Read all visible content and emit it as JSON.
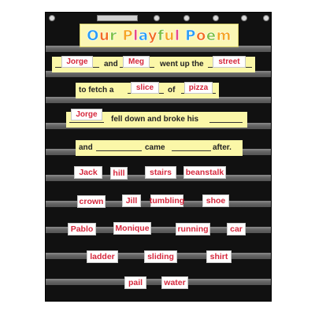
{
  "chart": {
    "title": "Our Playful Poem",
    "title_colors": [
      "#2a9df4",
      "#f36c21",
      "#7bc043",
      "#f5a623",
      "#e84a8a"
    ],
    "board_color": "#111111",
    "strip_color": "#fbf7a8",
    "word_color": "#d6283d"
  },
  "poem": {
    "line1": {
      "word1": "Jorge",
      "conj": "and",
      "word2": "Meg",
      "text": "went up the",
      "word3": "street"
    },
    "line2": {
      "text1": "to fetch a",
      "word1": "slice",
      "text2": "of",
      "word2": "pizza"
    },
    "line3": {
      "word1": "Jorge",
      "text": "fell down and broke his"
    },
    "line4": {
      "text1": "and",
      "text2": "came",
      "text3": "after."
    }
  },
  "word_bank": [
    "Jack",
    "hill",
    "stairs",
    "beanstalk",
    "crown",
    "Jill",
    "tumbling",
    "shoe",
    "Pablo",
    "Monique",
    "running",
    "car",
    "ladder",
    "sliding",
    "shirt",
    "pail",
    "water"
  ]
}
